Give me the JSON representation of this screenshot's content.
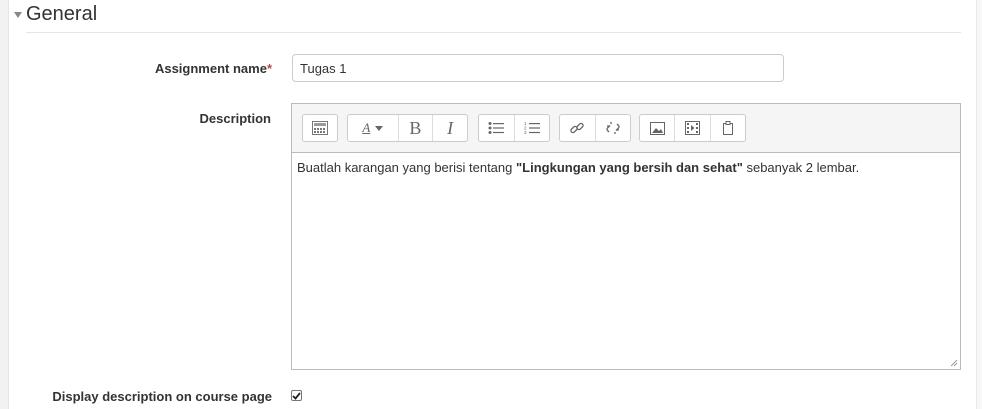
{
  "section": {
    "title": "General"
  },
  "assignment_name": {
    "label": "Assignment name",
    "required_marker": "*",
    "value": "Tugas 1"
  },
  "description": {
    "label": "Description",
    "text_before": "Buatlah karangan yang berisi tentang ",
    "text_bold": "\"Lingkungan yang bersih dan sehat\"",
    "text_after": " sebanyak 2 lembar.",
    "toolbar": {
      "font_button_label": "A",
      "bold_label": "B",
      "italic_label": "I"
    }
  },
  "display_description": {
    "label": "Display description on course page",
    "checked": true
  }
}
